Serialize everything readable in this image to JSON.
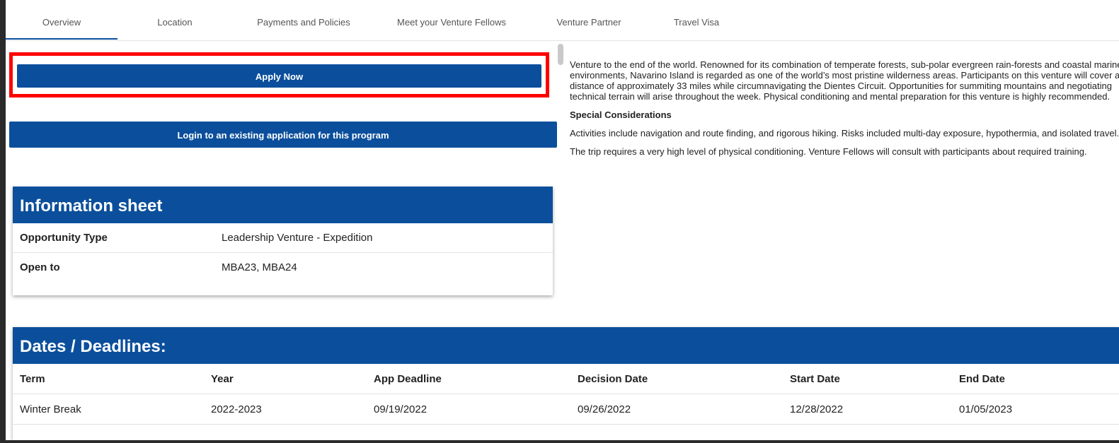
{
  "tabs": [
    {
      "label": "Overview"
    },
    {
      "label": "Location"
    },
    {
      "label": "Payments and Policies"
    },
    {
      "label": "Meet your Venture Fellows"
    },
    {
      "label": "Venture Partner"
    },
    {
      "label": "Travel Visa"
    }
  ],
  "buttons": {
    "apply": "Apply Now",
    "login": "Login to an existing application for this program"
  },
  "info_sheet": {
    "title": "Information sheet",
    "rows": [
      {
        "label": "Opportunity Type",
        "value": "Leadership Venture - Expedition"
      },
      {
        "label": "Open to",
        "value": "MBA23, MBA24"
      }
    ]
  },
  "description": {
    "intro": "Venture to the end of the world. Renowned for its combination of temperate forests, sub-polar evergreen rain-forests and coastal marine environments, Navarino Island is regarded as one of the world’s most pristine wilderness areas. Participants on this venture will cover a distance of approximately 33 miles while circumnavigating the Dientes Circuit. Opportunities for summiting mountains and negotiating technical terrain will arise throughout the week. Physical conditioning and mental preparation for this venture is highly recommended.",
    "special_heading": "Special Considerations",
    "special_1": "Activities include navigation and route finding, and rigorous hiking. Risks included multi-day exposure, hypothermia, and isolated travel.",
    "special_2": "The trip requires a very high level of physical conditioning.  Venture Fellows will consult with participants about required training."
  },
  "dates": {
    "title": "Dates / Deadlines:",
    "headers": [
      "Term",
      "Year",
      "App Deadline",
      "Decision Date",
      "Start Date",
      "End Date"
    ],
    "rows": [
      [
        "Winter Break",
        "2022-2023",
        "09/19/2022",
        "09/26/2022",
        "12/28/2022",
        "01/05/2023"
      ]
    ]
  },
  "colors": {
    "brand_blue": "#0b4f9c",
    "highlight_red": "#ff0000"
  }
}
